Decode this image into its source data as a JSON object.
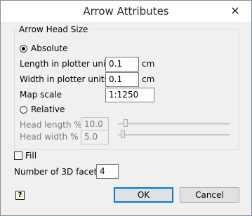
{
  "window": {
    "title": "Arrow Attributes",
    "close_glyph": "✕"
  },
  "arrow_head": {
    "group_label": "Arrow Head Size",
    "absolute": {
      "label": "Absolute",
      "selected": true,
      "length_label": "Length in plotter units",
      "length_value": "0.1",
      "length_unit": "cm",
      "width_label": "Width in plotter units",
      "width_value": "0.1",
      "width_unit": "cm",
      "map_scale_label": "Map scale",
      "map_scale_value": "1:1250"
    },
    "relative": {
      "label": "Relative",
      "selected": false,
      "head_length_label": "Head length %",
      "head_length_value": "10.0",
      "head_length_slider": 0.1,
      "head_width_label": "Head width %",
      "head_width_value": "5.0",
      "head_width_slider": 0.05
    }
  },
  "fill": {
    "label": "Fill",
    "checked": false
  },
  "facets": {
    "label": "Number of 3D facets",
    "value": "4"
  },
  "buttons": {
    "ok": "OK",
    "cancel": "Cancel",
    "help_glyph": "?"
  },
  "colors": {
    "accent": "#0078d7",
    "background": "#f0f0f0"
  }
}
